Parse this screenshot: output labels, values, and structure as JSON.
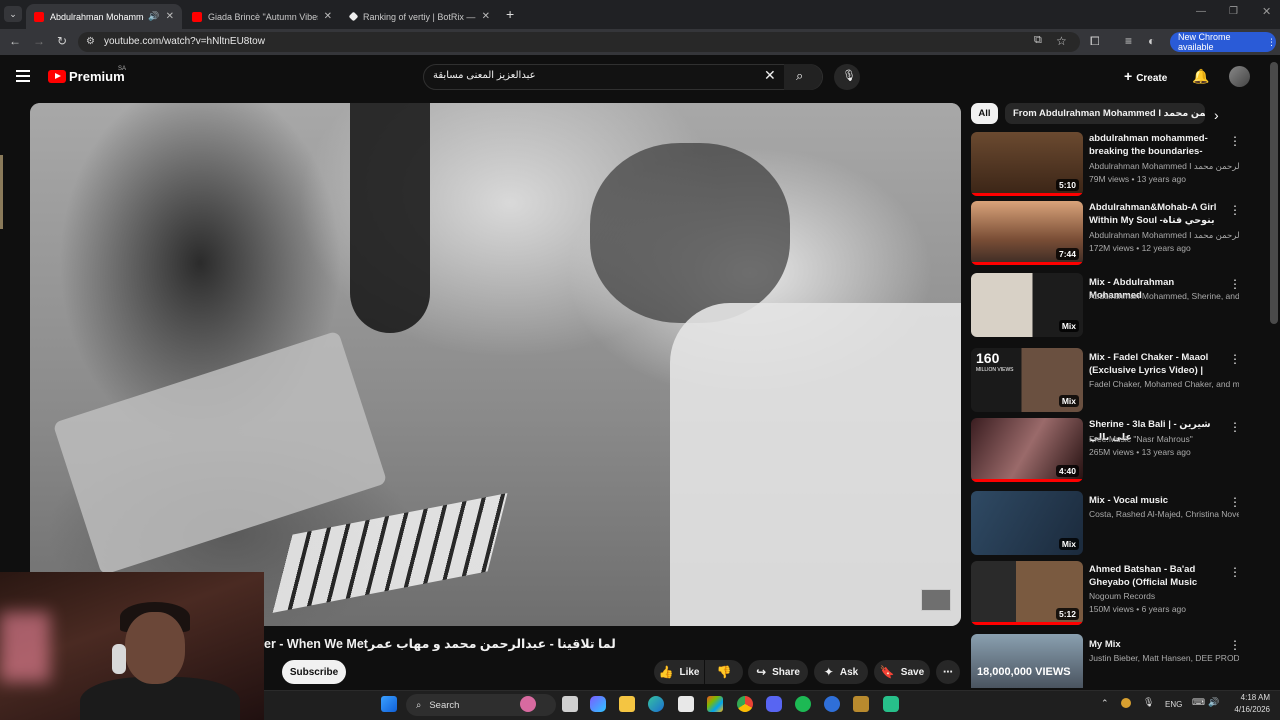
{
  "browser": {
    "tabs": [
      {
        "title": "Abdulrahman Mohammed",
        "active": true
      },
      {
        "title": "Giada Brincè \"Autumn Vibes Dj",
        "active": false
      },
      {
        "title": "Ranking of vertiy | BotRix — Ch",
        "active": false
      }
    ],
    "url": "youtube.com/watch?v=hNltnEU8tow",
    "new_chrome_label": "New Chrome available"
  },
  "header": {
    "logo_text": "Premium",
    "region": "SA",
    "search_value": "عبدالعزيز المعنى مسابقة",
    "create_label": "Create"
  },
  "video": {
    "title": "لما تلاقينا - عبدالرحمن محمد و مهاب عمرer - When We Met",
    "subscribe_label": "Subscribe",
    "actions": {
      "like": "Like",
      "share": "Share",
      "ask": "Ask",
      "save": "Save"
    }
  },
  "chips": {
    "all": "All",
    "from": "From Abdulrahman Mohammed I عبدالرحمن محمد"
  },
  "recommendations": [
    {
      "title": "abdulrahman mohammed- breaking the boundaries-yamn...",
      "channel": "Abdulrahman Mohammed I عبدالرحمن محمد",
      "meta": "79M views • 13 years ago",
      "badge": "5:10"
    },
    {
      "title": "Abdulrahman&Mohab-A Girl Within My Soul بنوحي فتاة-عبدالرحمن ...",
      "channel": "Abdulrahman Mohammed I عبدالرحمن محمد",
      "meta": "172M views • 12 years ago",
      "badge": "7:44"
    },
    {
      "title": "Mix - Abdulrahman Mohammed",
      "channel": "Abdulrahman Mohammed, Sherine, and ...",
      "meta": "",
      "badge": "Mix"
    },
    {
      "title": "Mix - Fadel Chaker - Maaol (Exclusive Lyrics Video) | فضل ...",
      "channel": "Fadel Chaker, Mohamed Chaker, and more",
      "meta": "",
      "badge": "Mix"
    },
    {
      "title": "Sherine - 3la Bali | شيرين - على بالي",
      "channel": "Free Music \"Nasr Mahrous\"",
      "meta": "265M views • 13 years ago",
      "badge": "4:40"
    },
    {
      "title": "Mix - Vocal music",
      "channel": "Costa, Rashed Al-Majed, Christina Novell...",
      "meta": "",
      "badge": "Mix"
    },
    {
      "title": "Ahmed Batshan - Ba'ad Gheyabo (Official Music Video...",
      "channel": "Nogoum Records",
      "meta": "150M views • 6 years ago",
      "badge": "5:12"
    },
    {
      "title": "My Mix",
      "channel": "Justin Bieber, Matt Hansen, DEE PRODU...",
      "meta": "",
      "badge": ""
    }
  ],
  "thumb_texts": {
    "fadel_views": "160",
    "fadel_views_sub": "MILLION VIEWS",
    "mymix_views": "18,000,000 VIEWS"
  },
  "taskbar": {
    "search_label": "Search",
    "lang": "ENG",
    "time": "4:18 AM",
    "date": "4/16/2026"
  },
  "colors": {
    "background": "#0f0f0f",
    "brand_red": "#ff0000",
    "chrome_blue": "#2a5bd7"
  }
}
